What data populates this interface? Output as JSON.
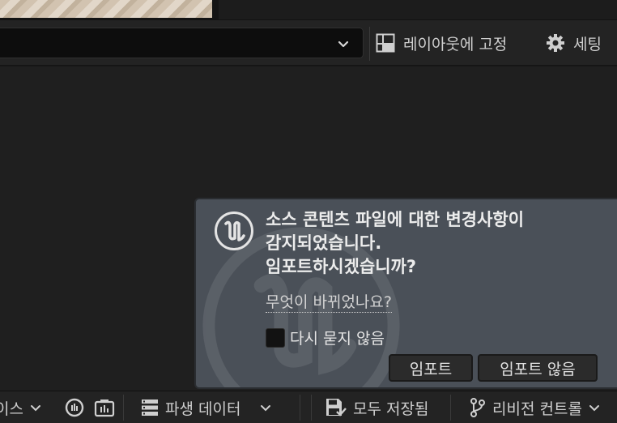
{
  "toolbar": {
    "lock_layout_label": "레이아웃에 고정",
    "settings_label": "세팅"
  },
  "notification": {
    "message_lines": [
      "소스 콘텐츠 파일에 대한 변경사항이",
      "감지되었습니다.",
      "임포트하시겠습니까?"
    ],
    "what_changed_link": "무엇이 바뀌었나요?",
    "dont_ask_label": "다시 묻지 않음",
    "dont_ask_checked": false,
    "import_button": "임포트",
    "dont_import_button": "임포트 않음"
  },
  "bottombar": {
    "trace_label_partial": "이스",
    "derived_data_label": "파생 데이터",
    "save_all_label": "모두 저장됨",
    "revision_control_label": "리비전 컨트롤"
  },
  "colors": {
    "background": "#1e1e1e",
    "notification_bg": "#4a5058",
    "button_bg": "#2b2b2b"
  }
}
